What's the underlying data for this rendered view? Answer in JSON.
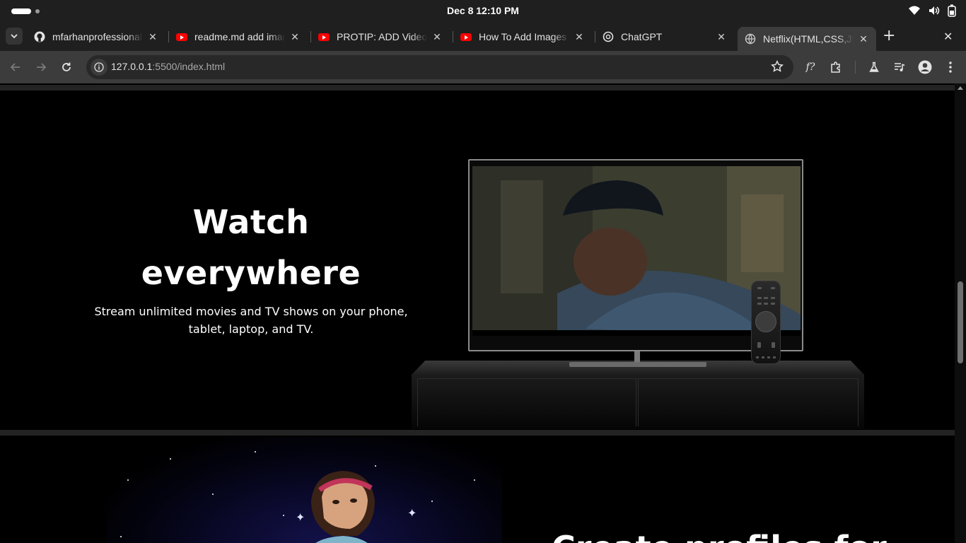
{
  "system": {
    "clock": "Dec 8  12:10 PM"
  },
  "tabs": [
    {
      "title": "mfarhanprofessional",
      "favicon": "github-icon",
      "active": false
    },
    {
      "title": "readme.md add images",
      "favicon": "youtube-icon",
      "active": false
    },
    {
      "title": "PROTIP: ADD Videos",
      "favicon": "youtube-icon",
      "active": false
    },
    {
      "title": "How To Add Images",
      "favicon": "youtube-icon",
      "active": false
    },
    {
      "title": "ChatGPT",
      "favicon": "chatgpt-icon",
      "active": false
    },
    {
      "title": "Netflix(HTML,CSS,JS)",
      "favicon": "globe-icon",
      "active": true
    }
  ],
  "toolbar": {
    "url_host": "127.0.0.1",
    "url_path": ":5500/index.html"
  },
  "feature": {
    "title_line1": "Watch",
    "title_line2": "everywhere",
    "description_line1": "Stream unlimited movies and TV shows on your phone,",
    "description_line2": "tablet, laptop, and TV."
  },
  "next_section": {
    "title_partial": "Create profiles for"
  },
  "colors": {
    "page_bg": "#000000",
    "divider": "#232323",
    "chrome_dark": "#1f1f1f",
    "chrome_toolbar": "#3c3c3c",
    "youtube_red": "#ff0000"
  }
}
